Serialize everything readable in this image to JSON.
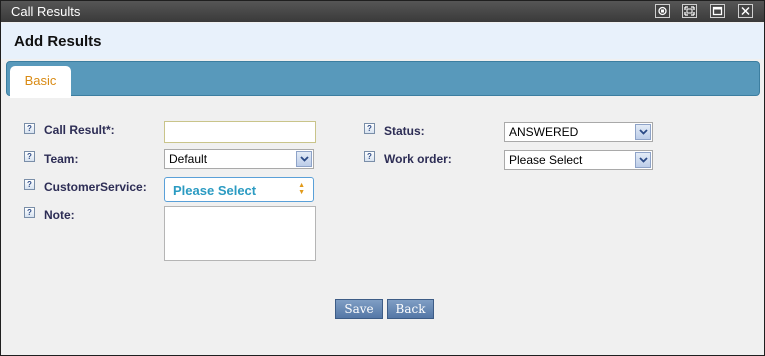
{
  "window": {
    "title": "Call Results"
  },
  "header": {
    "title": "Add Results"
  },
  "tabs": [
    {
      "label": "Basic",
      "active": true
    }
  ],
  "form": {
    "call_result": {
      "label": "Call Result*:",
      "value": ""
    },
    "team": {
      "label": "Team:",
      "value": "Default"
    },
    "customer_service": {
      "label": "CustomerService:",
      "value": "Please Select"
    },
    "note": {
      "label": "Note:",
      "value": ""
    },
    "status": {
      "label": "Status:",
      "value": "ANSWERED"
    },
    "work_order": {
      "label": "Work order:",
      "value": "Please Select"
    },
    "help_glyph": "?"
  },
  "buttons": {
    "save": "Save",
    "back": "Back"
  },
  "colors": {
    "tabbar": "#5899bb",
    "tab_text": "#d98b15",
    "header_bg": "#e8f1fb",
    "button": "#5f80ad"
  }
}
